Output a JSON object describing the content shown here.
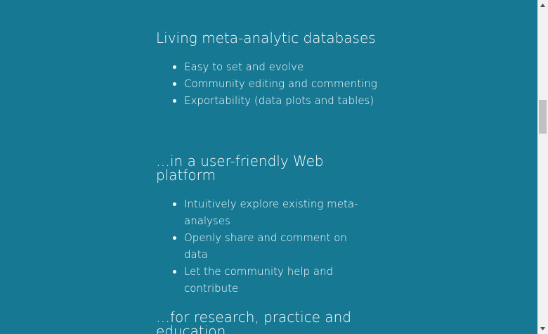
{
  "sections": [
    {
      "heading": "Living meta-analytic databases",
      "items": [
        "Easy to set and evolve",
        "Community editing and commenting",
        "Exportability (data plots and tables)"
      ]
    },
    {
      "heading": "…in a user-friendly Web platform",
      "items": [
        "Intuitively explore existing meta-analyses",
        "Openly share and comment on data",
        "Let the community help and contribute"
      ]
    },
    {
      "heading": "…for research, practice and education"
    }
  ],
  "colors": {
    "background": "#167893",
    "text": "#ffffff",
    "scrollbar_track": "#f1f1f1",
    "scrollbar_thumb": "#c1c1c1"
  },
  "icons": {
    "scroll_up": "triangle-up-icon",
    "scroll_down": "triangle-down-icon"
  }
}
